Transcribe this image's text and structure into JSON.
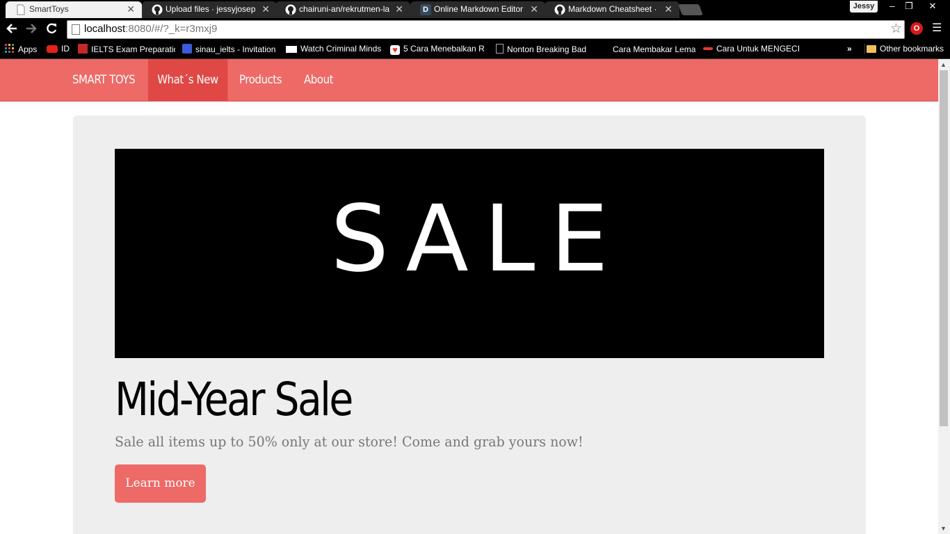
{
  "browser": {
    "tabs": [
      {
        "title": "SmartToys",
        "icon": "page-icon",
        "active": true
      },
      {
        "title": "Upload files · jessyjosephine",
        "icon": "github-icon",
        "active": false
      },
      {
        "title": "chairuni-an/rekrutmen-lab",
        "icon": "github-icon",
        "active": false
      },
      {
        "title": "Online Markdown Editor -",
        "icon": "dillinger-icon",
        "active": false
      },
      {
        "title": "Markdown Cheatsheet · ad",
        "icon": "github-icon",
        "active": false
      }
    ],
    "profile_name": "Jessy",
    "window_controls": {
      "minimize": "–",
      "restore": "❐",
      "close": "✕"
    },
    "url_host": "localhost",
    "url_path": ":8080/#/?_k=r3mxj9",
    "opera_label": "O",
    "bookmarks": [
      {
        "label": "Apps",
        "icon": "apps-grid-icon"
      },
      {
        "label": "ID",
        "icon": "youtube-icon"
      },
      {
        "label": "IELTS Exam Preparatio",
        "icon": "ielts-icon"
      },
      {
        "label": "sinau_ielts - Invitation",
        "icon": "chat-icon"
      },
      {
        "label": "Watch Criminal Minds",
        "icon": "tv-icon"
      },
      {
        "label": "5 Cara Menebalkan R",
        "icon": "heart-icon"
      },
      {
        "label": "Nonton Breaking Bad",
        "icon": "page-icon"
      },
      {
        "label": "Cara Membakar Lema",
        "icon": "blank-icon"
      },
      {
        "label": "Cara Untuk MENGECIL",
        "icon": "swoosh-icon"
      }
    ],
    "bookmarks_overflow": "»",
    "other_bookmarks": "Other bookmarks"
  },
  "navbar": {
    "brand": "SMART TOYS",
    "links": [
      {
        "label": "What´s New",
        "active": true
      },
      {
        "label": "Products",
        "active": false
      },
      {
        "label": "About",
        "active": false
      }
    ]
  },
  "hero": {
    "banner_text": "SALE",
    "title": "Mid-Year Sale",
    "lead": "Sale all items up to 50% only at our store! Come and grab yours now!",
    "button_label": "Learn more"
  },
  "colors": {
    "navbar": "#ed6a66",
    "navbar_active": "#e04845",
    "jumbotron": "#eeeeee",
    "button": "#ed6a66"
  }
}
